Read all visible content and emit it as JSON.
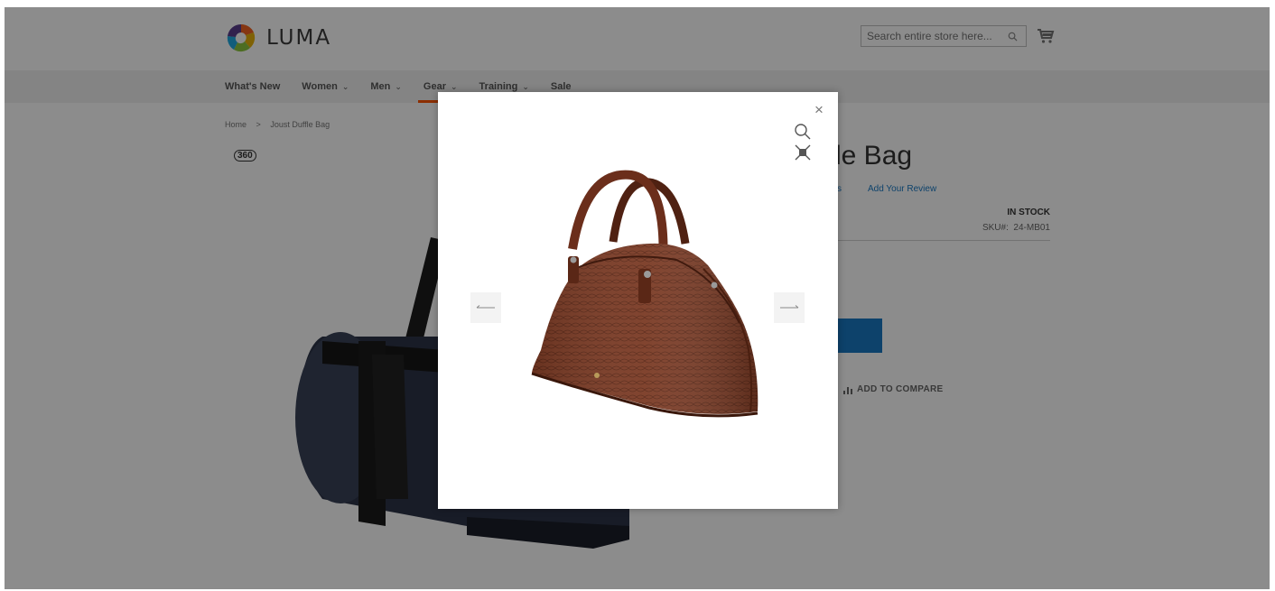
{
  "brand": {
    "name": "LUMA"
  },
  "search": {
    "placeholder": "Search entire store here..."
  },
  "nav": {
    "items": [
      {
        "label": "What's New",
        "has_dropdown": false,
        "active": false
      },
      {
        "label": "Women",
        "has_dropdown": true,
        "active": false
      },
      {
        "label": "Men",
        "has_dropdown": true,
        "active": false
      },
      {
        "label": "Gear",
        "has_dropdown": true,
        "active": true
      },
      {
        "label": "Training",
        "has_dropdown": true,
        "active": false
      },
      {
        "label": "Sale",
        "has_dropdown": false,
        "active": false
      }
    ]
  },
  "breadcrumb": {
    "home": "Home",
    "separator": ">",
    "current": "Joust Duffle Bag"
  },
  "gallery": {
    "badge": "360"
  },
  "product": {
    "title_visible": "le Bag",
    "reviews_partial": "s",
    "add_review": "Add Your Review",
    "stock": "IN STOCK",
    "sku_label": "SKU#:",
    "sku": "24-MB01",
    "compare": "ADD TO COMPARE"
  },
  "modal": {
    "close_symbol": "×",
    "prev_icon": "arrow-left-icon",
    "next_icon": "arrow-right-icon"
  },
  "colors": {
    "accent": "#ff5501",
    "link": "#1979c3",
    "bag_brown": "#7a3a24",
    "duffle_navy": "#2c3347"
  }
}
